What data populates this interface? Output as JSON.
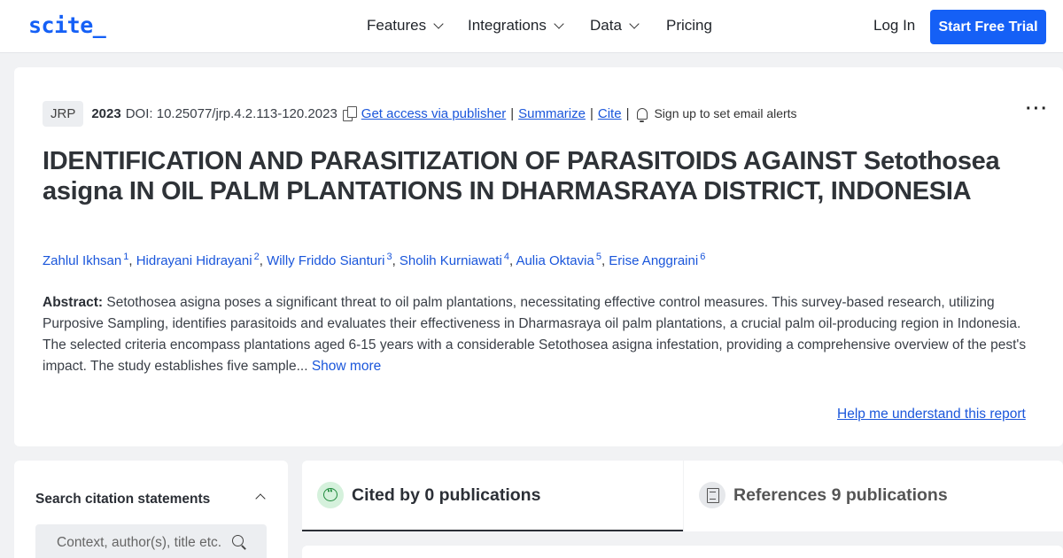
{
  "nav": {
    "logo": "scite_",
    "items": [
      {
        "label": "Features",
        "dropdown": true
      },
      {
        "label": "Integrations",
        "dropdown": true
      },
      {
        "label": "Data",
        "dropdown": true
      },
      {
        "label": "Pricing",
        "dropdown": false
      }
    ],
    "login": "Log In",
    "trial": "Start Free Trial"
  },
  "colors": {
    "accent": "#1560f6",
    "link": "#1a56db",
    "cite_green": "#1f8a3c"
  },
  "paper": {
    "journal": "JRP",
    "year": "2023",
    "doi": "DOI: 10.25077/jrp.4.2.113-120.2023",
    "access_link": "Get access via publisher",
    "summarize_link": "Summarize",
    "cite_link": "Cite",
    "alerts": "Sign up to set email alerts",
    "title": "IDENTIFICATION AND PARASITIZATION OF PARASITOIDS AGAINST Setothosea asigna IN OIL PALM PLANTATIONS IN DHARMASRAYA DISTRICT, INDONESIA",
    "authors": [
      {
        "name": "Zahlul Ikhsan",
        "num": "1"
      },
      {
        "name": "Hidrayani Hidrayani",
        "num": "2"
      },
      {
        "name": "Willy Friddo Sianturi",
        "num": "3"
      },
      {
        "name": "Sholih Kurniawati",
        "num": "4"
      },
      {
        "name": "Aulia Oktavia",
        "num": "5"
      },
      {
        "name": "Erise Anggraini",
        "num": "6"
      }
    ],
    "abstract_label": "Abstract:",
    "abstract": "Setothosea asigna poses a significant threat to oil palm plantations, necessitating effective control measures. This survey-based research, utilizing Purposive Sampling, identifies parasitoids and evaluates their effectiveness in Dharmasraya oil palm plantations, a crucial palm oil-producing region in Indonesia. The selected criteria encompass plantations aged 6-15 years with a considerable Setothosea asigna infestation, providing a comprehensive overview of the pest's impact. The study establishes five sample...",
    "show_more": "Show more",
    "help": "Help me understand this report"
  },
  "sidebar": {
    "search_heading": "Search citation statements",
    "search_placeholder": "Context, author(s), title etc."
  },
  "tabs": [
    {
      "label": "Cited by 0 publications",
      "icon": "quote-bubble-icon"
    },
    {
      "label": "References 9 publications",
      "icon": "document-icon"
    }
  ]
}
